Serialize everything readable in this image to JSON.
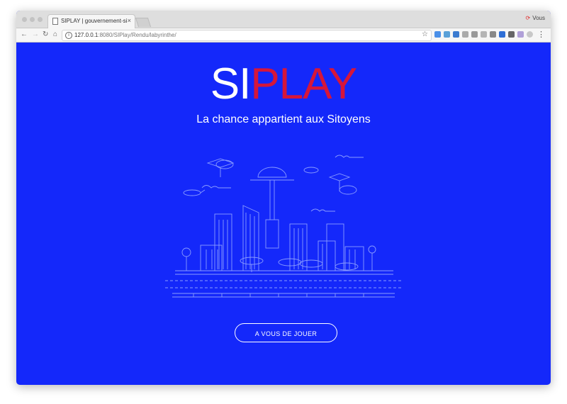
{
  "browser": {
    "tab_title": "SIPLAY | gouvernement-si",
    "url_host": "127.0.0.1",
    "url_rest": ":8080/SIPlay/Rendu/labyrinthe/",
    "profile_name": "Vous"
  },
  "page": {
    "logo_part1": "SI",
    "logo_part2": "PLAY",
    "tagline": "La chance appartient aux Sitoyens",
    "cta_label": "A VOUS DE JOUER"
  },
  "colors": {
    "background": "#1428fa",
    "logo_accent": "#d6163a",
    "text": "#ffffff"
  }
}
